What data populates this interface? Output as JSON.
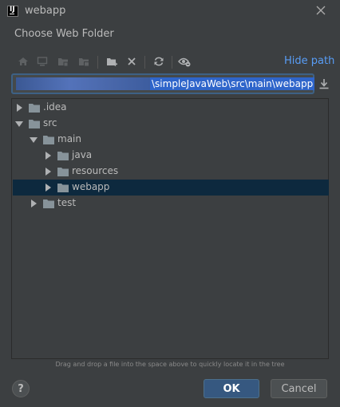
{
  "window": {
    "title": "webapp",
    "app_icon": "intellij-idea-icon",
    "close_icon": "close-icon"
  },
  "dialog": {
    "subtitle": "Choose Web Folder"
  },
  "toolbar": {
    "buttons": [
      {
        "icon": "home-icon",
        "enabled": false
      },
      {
        "icon": "desktop-icon",
        "enabled": false
      },
      {
        "icon": "project-folder-icon",
        "enabled": false
      },
      {
        "icon": "module-folder-icon",
        "enabled": false
      },
      {
        "icon": "new-folder-icon",
        "enabled": true
      },
      {
        "icon": "delete-icon",
        "enabled": true
      },
      {
        "icon": "refresh-icon",
        "enabled": true
      },
      {
        "icon": "show-hidden-icon",
        "enabled": true
      }
    ],
    "hide_path_label": "Hide path"
  },
  "path": {
    "value": "\\simpleJavaWeb\\src\\main\\webapp",
    "download_icon": "download-icon"
  },
  "tree": {
    "nodes": [
      {
        "label": ".idea",
        "depth": 0,
        "expanded": false,
        "selected": false
      },
      {
        "label": "src",
        "depth": 0,
        "expanded": true,
        "selected": false
      },
      {
        "label": "main",
        "depth": 1,
        "expanded": true,
        "selected": false
      },
      {
        "label": "java",
        "depth": 2,
        "expanded": false,
        "selected": false
      },
      {
        "label": "resources",
        "depth": 2,
        "expanded": false,
        "selected": false
      },
      {
        "label": "webapp",
        "depth": 2,
        "expanded": false,
        "selected": true
      },
      {
        "label": "test",
        "depth": 1,
        "expanded": false,
        "selected": false
      }
    ]
  },
  "hint": "Drag and drop a file into the space above to quickly locate it in the tree",
  "buttons": {
    "help_label": "?",
    "ok_label": "OK",
    "cancel_label": "Cancel"
  },
  "colors": {
    "background": "#3c3f41",
    "link": "#589df6",
    "selection": "#0d293e",
    "primary_button": "#365880"
  }
}
